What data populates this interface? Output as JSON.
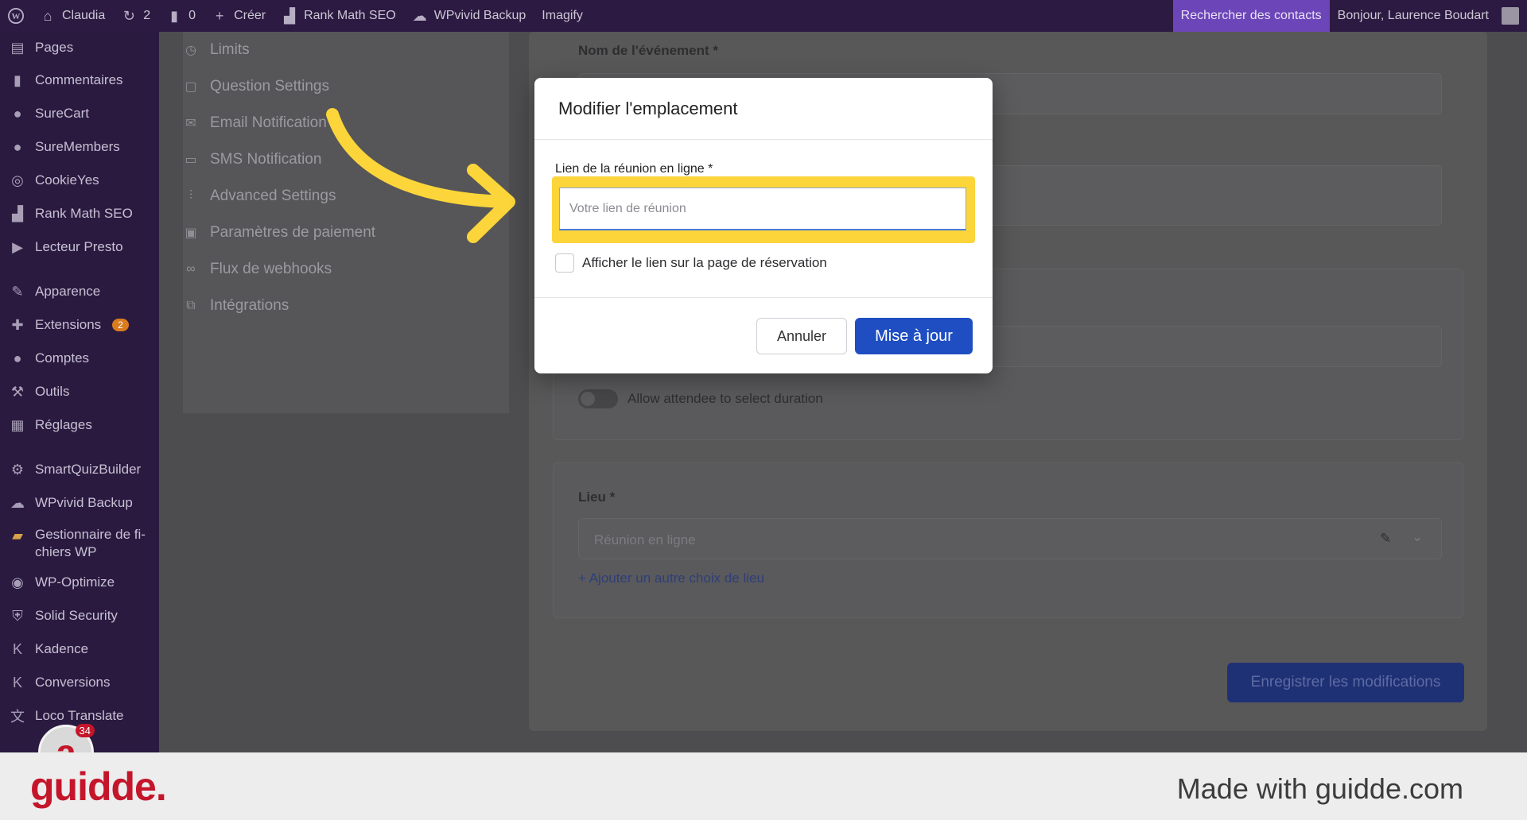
{
  "admin_bar": {
    "site_name": "Claudia",
    "updates_count": "2",
    "comments_count": "0",
    "create_label": "Créer",
    "rank_math_label": "Rank Math SEO",
    "wpvivid_label": "WPvivid Backup",
    "imagify_label": "Imagify",
    "search_contacts_label": "Rechercher des contacts",
    "greeting": "Bonjour, Laurence Boudart"
  },
  "sidebar": {
    "items": [
      {
        "label": "Pages",
        "icon": "pages-icon"
      },
      {
        "label": "Commentaires",
        "icon": "comments-icon"
      },
      {
        "label": "SureCart",
        "icon": "surecart-icon"
      },
      {
        "label": "SureMembers",
        "icon": "suremembers-icon"
      },
      {
        "label": "CookieYes",
        "icon": "cookieyes-icon"
      },
      {
        "label": "Rank Math SEO",
        "icon": "rankmath-icon"
      },
      {
        "label": "Lecteur Presto",
        "icon": "presto-icon"
      },
      {
        "label": "Apparence",
        "icon": "appearance-icon"
      },
      {
        "label": "Extensions",
        "icon": "plugins-icon",
        "badge": "2"
      },
      {
        "label": "Comptes",
        "icon": "users-icon"
      },
      {
        "label": "Outils",
        "icon": "tools-icon"
      },
      {
        "label": "Réglages",
        "icon": "settings-icon"
      },
      {
        "label": "SmartQuizBuilder",
        "icon": "gear-icon"
      },
      {
        "label": "WPvivid Backup",
        "icon": "cloud-icon"
      },
      {
        "label": "Gestionnaire de fi- chiers WP",
        "icon": "folder-icon"
      },
      {
        "label": "WP-Optimize",
        "icon": "optimize-icon"
      },
      {
        "label": "Solid Security",
        "icon": "shield-icon"
      },
      {
        "label": "Kadence",
        "icon": "kadence-icon"
      },
      {
        "label": "Conversions",
        "icon": "conversions-icon"
      },
      {
        "label": "Loco Translate",
        "icon": "translate-icon"
      }
    ]
  },
  "settings_nav": {
    "items": [
      {
        "label": "Limits",
        "icon": "clock-icon"
      },
      {
        "label": "Question Settings",
        "icon": "question-icon"
      },
      {
        "label": "Email Notification",
        "icon": "mail-icon"
      },
      {
        "label": "SMS Notification",
        "icon": "sms-icon"
      },
      {
        "label": "Advanced Settings",
        "icon": "sliders-icon"
      },
      {
        "label": "Paramètres de paiement",
        "icon": "payment-icon"
      },
      {
        "label": "Flux de webhooks",
        "icon": "link-icon"
      },
      {
        "label": "Intégrations",
        "icon": "integrations-icon"
      }
    ]
  },
  "event_form": {
    "event_name_label": "Nom de l'événement *",
    "allow_duration_label": "Allow attendee to select duration",
    "location_label": "Lieu *",
    "location_value": "Réunion en ligne",
    "add_location_link": "+ Ajouter un autre choix de lieu",
    "save_button": "Enregistrer les modifications"
  },
  "modal": {
    "title": "Modifier l'emplacement",
    "field_label": "Lien de la réunion en ligne *",
    "field_placeholder": "Votre lien de réunion",
    "field_value": "",
    "checkbox_label": "Afficher le lien sur la page de réservation",
    "checkbox_checked": false,
    "cancel_button": "Annuler",
    "update_button": "Mise à jour"
  },
  "overlay": {
    "notification_count": "34"
  },
  "footer": {
    "brand": "guidde.",
    "made_with": "Made with guidde.com"
  },
  "colors": {
    "admin_bar_bg": "#2c1a42",
    "sidebar_bg": "#2a1a40",
    "highlight": "#fbd53a",
    "primary_button": "#1f4ec2",
    "brand_red": "#c4152a"
  }
}
